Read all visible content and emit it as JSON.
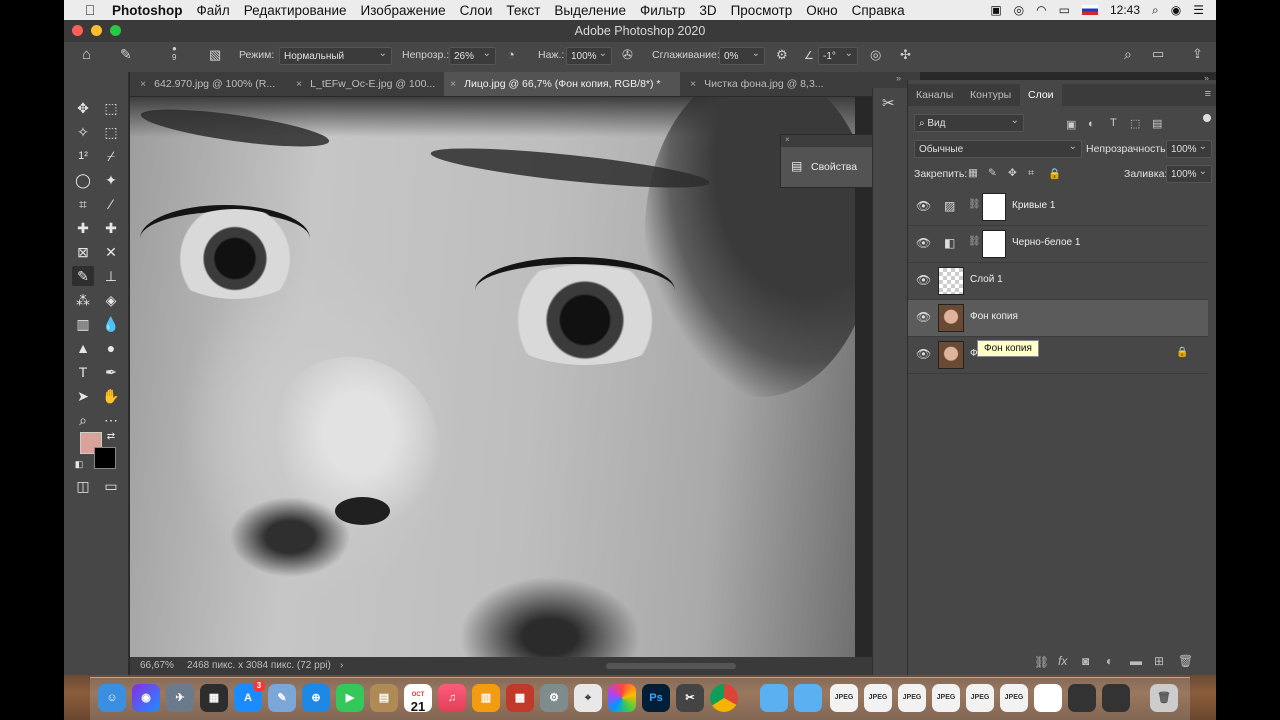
{
  "menubar": {
    "app": "Photoshop",
    "items": [
      "Файл",
      "Редактирование",
      "Изображение",
      "Слои",
      "Текст",
      "Выделение",
      "Фильтр",
      "3D",
      "Просмотр",
      "Окно",
      "Справка"
    ],
    "time": "12:43"
  },
  "window": {
    "title": "Adobe Photoshop 2020"
  },
  "options": {
    "mode_label": "Режим:",
    "mode_value": "Нормальный",
    "opacity_label": "Непрозр.:",
    "opacity_value": "26%",
    "pressure_label": "Наж.:",
    "pressure_value": "100%",
    "smoothing_label": "Сглаживание:",
    "smoothing_value": "0%",
    "angle_value": "-1°",
    "brush_size": "9"
  },
  "tabs": [
    {
      "label": "642.970.jpg @ 100% (R..."
    },
    {
      "label": "L_tEFw_Oc-E.jpg @ 100..."
    },
    {
      "label": "Лицо.jpg @ 66,7% (Фон копия, RGB/8*) *"
    },
    {
      "label": "Чистка фона.jpg @ 8,3..."
    }
  ],
  "properties": {
    "title": "Свойства"
  },
  "status": {
    "zoom": "66,67%",
    "info": "2468 пикс. x 3084 пикс. (72 ppi)",
    "arrow": "›"
  },
  "layers_panel": {
    "tabs": [
      "Каналы",
      "Контуры",
      "Слои"
    ],
    "filter_label": "Вид",
    "blend_mode": "Обычные",
    "opacity_label": "Непрозрачность:",
    "opacity_value": "100%",
    "lock_label": "Закрепить:",
    "fill_label": "Заливка:",
    "fill_value": "100%",
    "layers": [
      {
        "name": "Кривые 1"
      },
      {
        "name": "Черно-белое 1"
      },
      {
        "name": "Слой 1"
      },
      {
        "name": "Фон копия"
      },
      {
        "name": "Фон"
      }
    ],
    "tooltip": "Фон копия"
  },
  "colors": {
    "foreground": "#d9a399",
    "background": "#000000",
    "panel": "#474747"
  },
  "dock": {
    "calendar_month": "OCT",
    "calendar_day": "21",
    "ps_label": "Ps",
    "badge": "3"
  }
}
